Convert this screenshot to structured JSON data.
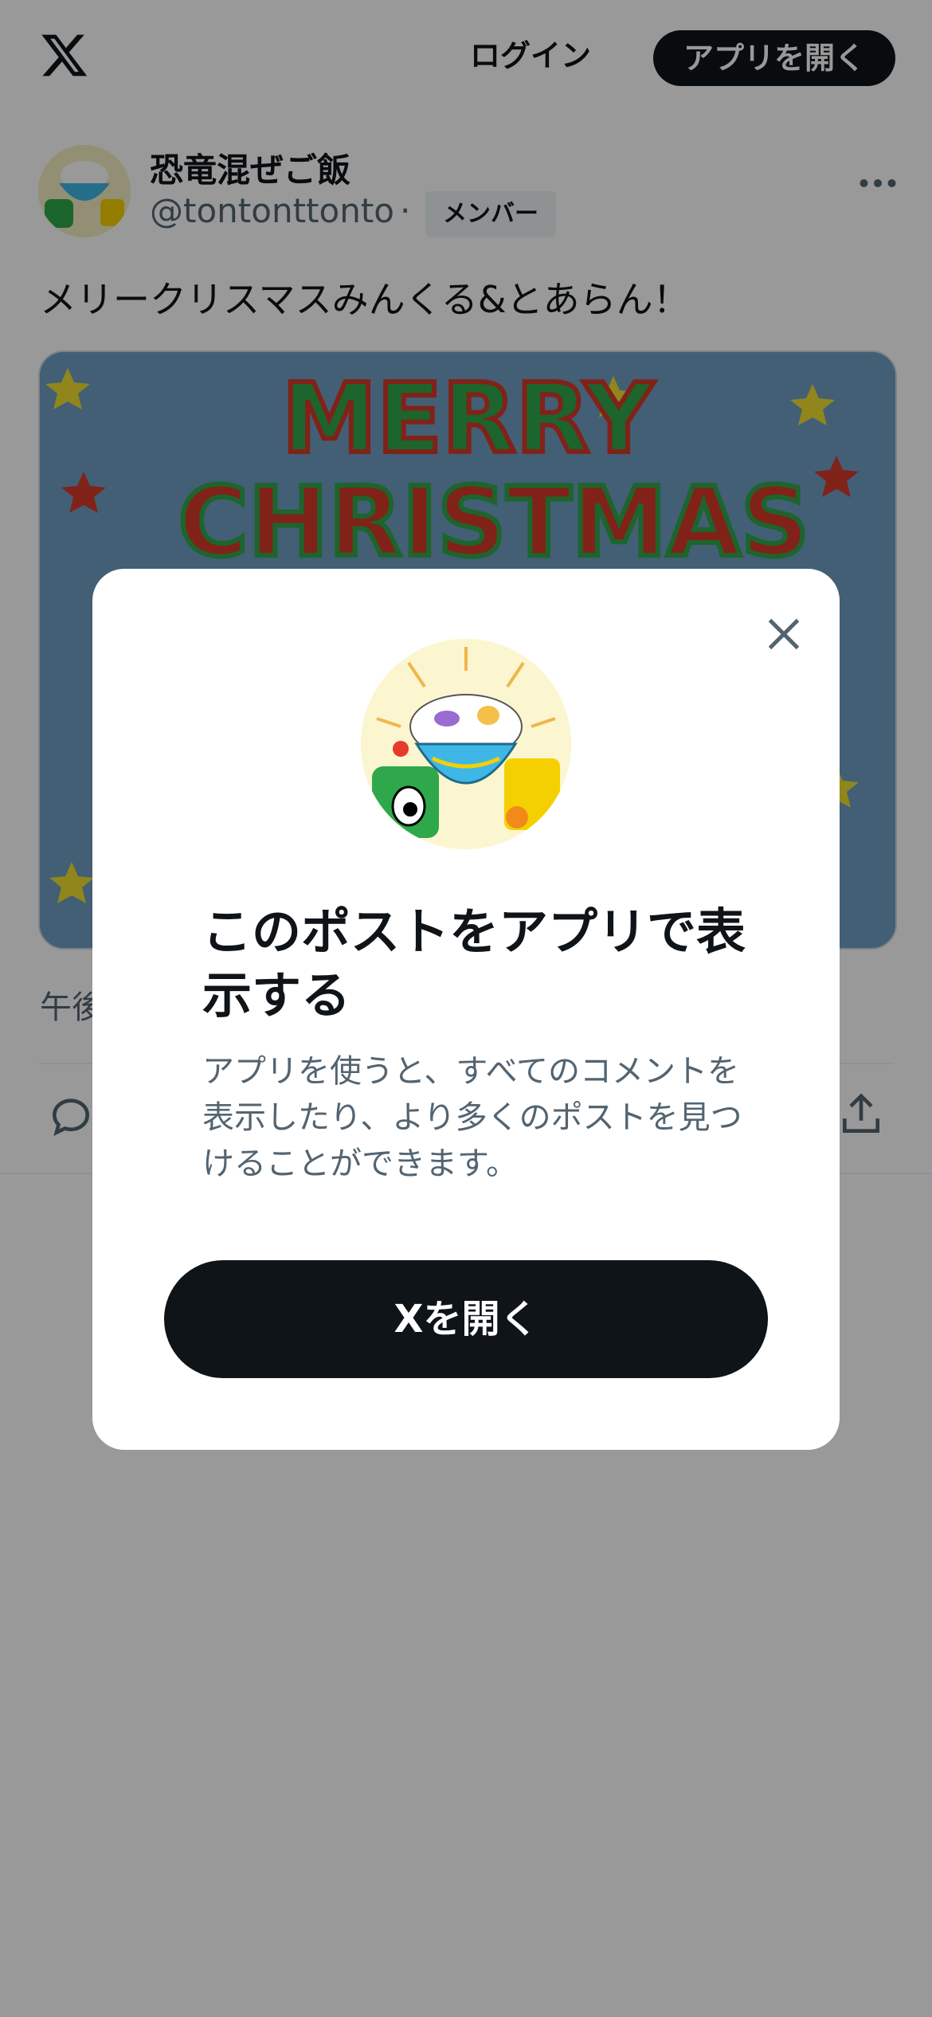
{
  "header": {
    "logo_icon": "x-logo-icon",
    "login_label": "ログイン",
    "open_app_label": "アプリを開く"
  },
  "post": {
    "author_name": "恐竜混ぜご飯",
    "author_handle": "@tontonttonto",
    "separator": "·",
    "badge": "メンバー",
    "more_icon": "more-horizontal-icon",
    "text": "メリークリスマスみんくる&とあらん！",
    "media_text": "MERRY CHRISTMAS",
    "timestamp_partial": "午後",
    "actions": {
      "reply_icon": "reply-icon",
      "share_icon": "share-icon"
    }
  },
  "modal": {
    "close_icon": "close-icon",
    "title": "このポストをアプリで表示する",
    "description": "アプリを使うと、すべてのコメントを表示したり、より多くのポストを見つけることができます。",
    "button_label": "Xを開く"
  },
  "colors": {
    "primary_dark": "#0f1419",
    "secondary_text": "#536471",
    "overlay": "rgba(0,0,0,0.4)",
    "media_bg": "#6f9fc3"
  }
}
